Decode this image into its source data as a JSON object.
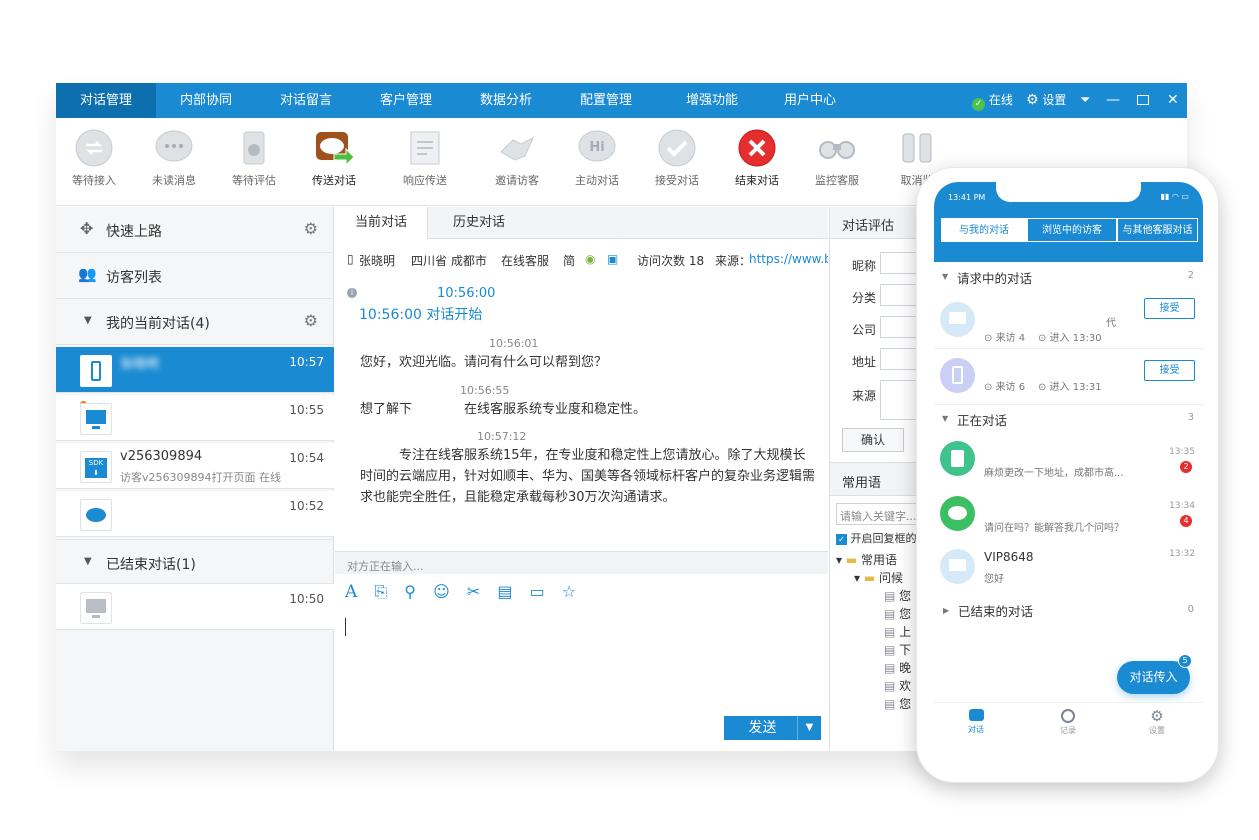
{
  "menubar": {
    "tabs": [
      "对话管理",
      "内部协同",
      "对话留言",
      "客户管理",
      "数据分析",
      "配置管理",
      "增强功能",
      "用户中心"
    ],
    "status": "在线",
    "settings": "设置"
  },
  "toolbar": {
    "items": [
      "等待接入",
      "未读消息",
      "等待评估",
      "传送对话",
      "响应传送",
      "邀请访客",
      "主动对话",
      "接受对话",
      "结束对话",
      "监控客服",
      "取消监"
    ]
  },
  "sidebar": {
    "quick_start": "快速上路",
    "visitor_list": "访客列表",
    "current_section": "我的当前对话(4)",
    "ended_section": "已结束对话(1)",
    "conversations": [
      {
        "name": "张晓明",
        "sub": "",
        "time": "10:57"
      },
      {
        "name": "",
        "sub": "",
        "time": "10:55"
      },
      {
        "name": "v256309894",
        "sub": "访客v256309894打开页面 在线",
        "time": "10:54"
      },
      {
        "name": "",
        "sub": "",
        "time": "10:52"
      }
    ],
    "ended": [
      {
        "name": "",
        "sub": "",
        "time": "10:50"
      }
    ]
  },
  "chat": {
    "tabs": [
      "当前对话",
      "历史对话"
    ],
    "info": {
      "name": "张晓明",
      "location": "四川省 成都市",
      "service": "在线客服",
      "lang": "简",
      "visits": "访问次数 18",
      "source_label": "来源：",
      "source_value": "https://www.b"
    },
    "start_time": "10:56:00",
    "start_text": "10:56:00 对话开始",
    "messages": [
      {
        "meta": "10:56:01",
        "text": "您好，欢迎光临。请问有什么可以帮到您？"
      },
      {
        "meta": "10:56:55",
        "text": "想了解下　　　　在线客服系统专业度和稳定性。"
      },
      {
        "meta": "10:57:12",
        "text": "　　　专注在线客服系统15年，在专业度和稳定性上您请放心。除了大规模长时间的云端应用，针对如顺丰、华为、国美等各领域标杆客户的复杂业务逻辑需求也能完全胜任，且能稳定承载每秒30万次沟通请求。"
      }
    ],
    "typing": "对方正在输入...",
    "send": "发送"
  },
  "right": {
    "tab": "对话评估",
    "fields": [
      "昵称",
      "分类",
      "公司",
      "地址",
      "来源"
    ],
    "confirm": "确认",
    "common_tab": "常用语",
    "search_placeholder": "请输入关键字...",
    "auto_reply": "开启回复框的",
    "tree_root": "常用语",
    "tree_child": "问候",
    "tree_leaves": [
      "您",
      "您",
      "上",
      "下",
      "晚",
      "欢",
      "您"
    ]
  },
  "phone": {
    "clock": "13:41 PM",
    "tabs": [
      "与我的对话",
      "浏览中的访客",
      "与其他客服对话"
    ],
    "requesting": {
      "title": "请求中的对话",
      "count": "2"
    },
    "requests": [
      {
        "sub1": "来访 4",
        "sub2": "进入 13:30",
        "extra": "代",
        "btn": "接受"
      },
      {
        "sub1": "来访 6",
        "sub2": "进入 13:31",
        "extra": "",
        "btn": "接受"
      }
    ],
    "active": {
      "title": "正在对话",
      "count": "3"
    },
    "chats": [
      {
        "name": "",
        "msg": "麻烦更改一下地址，成都市高...",
        "time": "13:35",
        "badge": "2"
      },
      {
        "name": "",
        "msg": "请问在吗？能解答我几个问吗？",
        "time": "13:34",
        "badge": "4"
      },
      {
        "name": "VIP8648",
        "msg": "您好",
        "time": "13:32",
        "badge": ""
      }
    ],
    "ended": {
      "title": "已结束的对话",
      "count": "0"
    },
    "fab": "对话传入",
    "fab_badge": "5",
    "nav": [
      "对话",
      "记录",
      "设置"
    ]
  },
  "colors": {
    "primary": "#1a8ad2",
    "dark_primary": "#0e6fae",
    "danger": "#e62e2e",
    "online": "#4cc24c"
  }
}
